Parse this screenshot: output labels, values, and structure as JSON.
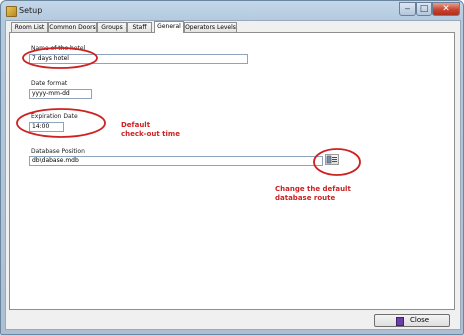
{
  "window": {
    "title": "Setup",
    "minimize_glyph": "‒",
    "maximize_glyph": "□",
    "close_glyph": "✕"
  },
  "tabs": [
    {
      "label": "Room List"
    },
    {
      "label": "Common Doors"
    },
    {
      "label": "Groups"
    },
    {
      "label": "Staff"
    },
    {
      "label": "General",
      "active": true
    },
    {
      "label": "Operators Levels"
    }
  ],
  "general": {
    "hotel_name_label": "Name of the hotel",
    "hotel_name_value": "7 days hotel",
    "date_format_label": "Date format",
    "date_format_value": "yyyy-mm-dd",
    "expiration_label": "Expiration Date",
    "expiration_value": "14:00",
    "db_position_label": "Database Position",
    "db_position_value": "db\\dabase.mdb"
  },
  "annotations": {
    "checkout_line1": "Default",
    "checkout_line2": "check-out time",
    "route_line1": "Change the default",
    "route_line2": "database route"
  },
  "footer": {
    "close_label": "Close"
  },
  "colors": {
    "annotation": "#cc2222",
    "titlebar": "#c4d7ea",
    "close_button": "#c8452e"
  },
  "icons": {
    "app": "app-icon",
    "database": "database-icon",
    "close": "door-icon"
  }
}
